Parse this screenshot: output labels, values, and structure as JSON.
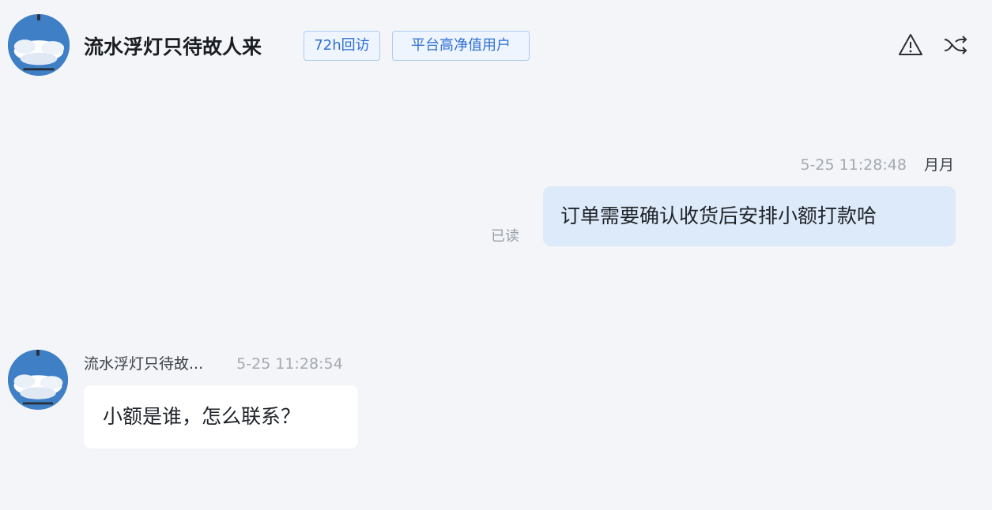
{
  "header": {
    "title": "流水浮灯只待故人来",
    "tags": [
      "72h回访",
      "平台高净值用户"
    ],
    "actions": [
      "warning-icon",
      "shuffle-icon"
    ]
  },
  "messages": [
    {
      "direction": "outgoing",
      "time": "5-25 11:28:48",
      "sender": "月月",
      "text": "订单需要确认收货后安排小额打款哈",
      "status": "已读"
    },
    {
      "direction": "incoming",
      "sender": "流水浮灯只待故...",
      "time": "5-25 11:28:54",
      "text": "小额是谁，怎么联系？"
    }
  ],
  "colors": {
    "background": "#f3f5f8",
    "tag_border": "#aecbef",
    "tag_text": "#2f6fd0",
    "outgoing_bubble": "#ddeaf9",
    "incoming_bubble": "#ffffff"
  }
}
